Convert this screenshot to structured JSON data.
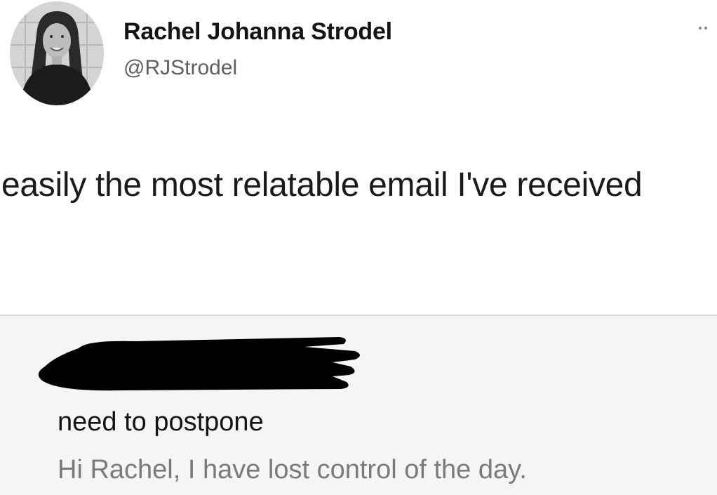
{
  "tweet": {
    "author": {
      "display_name": "Rachel Johanna Strodel",
      "handle": "@RJStrodel",
      "avatar_icon": "profile-photo"
    },
    "more_icon": "more-options-icon",
    "text": "easily the most relatable email I've received"
  },
  "email": {
    "sender_redacted": true,
    "subject": "need to postpone",
    "preview": "Hi Rachel, I have lost control of the day."
  },
  "colors": {
    "background": "#ffffff",
    "handle": "#5f5f5f",
    "email_card_background": "#f5f5f5",
    "email_preview": "#7a7a7a",
    "redaction": "#000000"
  }
}
